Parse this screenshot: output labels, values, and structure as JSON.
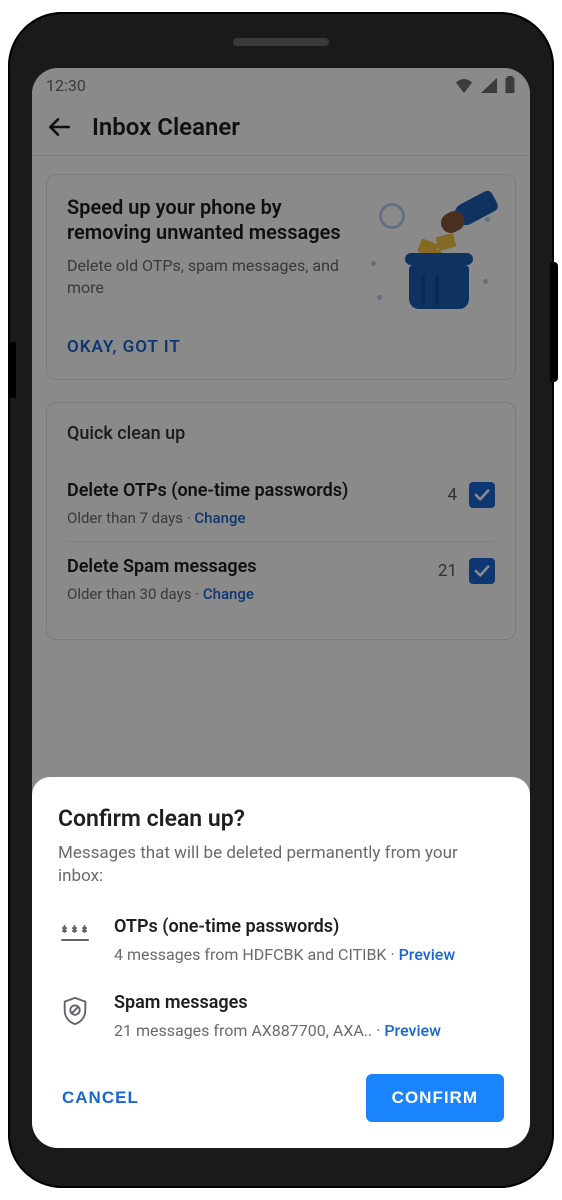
{
  "status": {
    "time": "12:30"
  },
  "appbar": {
    "title": "Inbox Cleaner"
  },
  "intro": {
    "heading": "Speed up your phone by removing unwanted messages",
    "sub": "Delete old OTPs, spam messages, and more",
    "cta": "OKAY, GOT IT"
  },
  "quick": {
    "heading": "Quick clean up",
    "rows": [
      {
        "title": "Delete OTPs (one-time passwords)",
        "sub_prefix": "Older than 7 days · ",
        "change_label": "Change",
        "count": "4",
        "checked": true
      },
      {
        "title": "Delete Spam messages",
        "sub_prefix": "Older than 30 days · ",
        "change_label": "Change",
        "count": "21",
        "checked": true
      }
    ]
  },
  "sheet": {
    "title": "Confirm clean up?",
    "sub": "Messages that will be deleted permanently from your inbox:",
    "items": [
      {
        "icon": "otp",
        "title": "OTPs (one-time passwords)",
        "detail_prefix": "4 messages from HDFCBK and CITIBK · ",
        "preview_label": "Preview"
      },
      {
        "icon": "spam",
        "title": "Spam messages",
        "detail_prefix": "21 messages from AX887700, AXA.. · ",
        "preview_label": "Preview"
      }
    ],
    "cancel": "CANCEL",
    "confirm": "CONFIRM"
  },
  "colors": {
    "accent": "#1967d2",
    "confirm_bg": "#1a84ff"
  }
}
